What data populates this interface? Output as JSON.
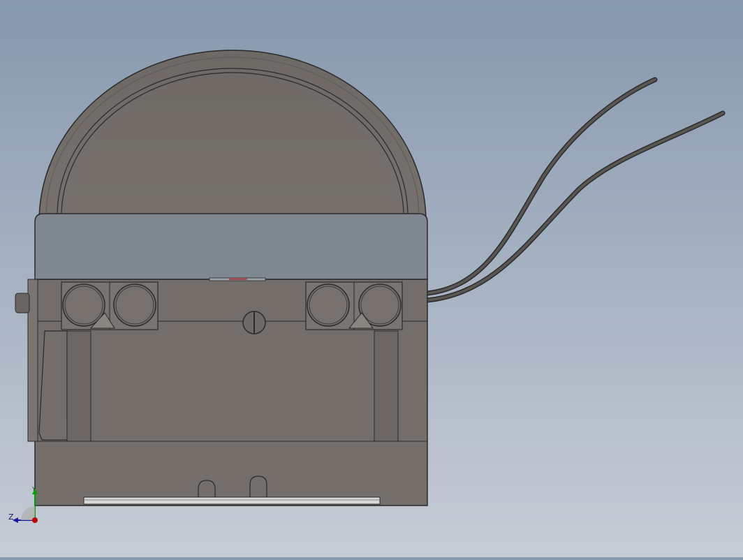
{
  "viewport": {
    "background_top": "#8799ae",
    "background_bottom": "#c7ccd6",
    "model": {
      "body_color": "#736e6a",
      "band_color": "#7f8891",
      "edge_color": "#2a2a2a",
      "wire_color": "#5a5652",
      "roller_count": 4,
      "wire_count": 2
    },
    "triad": {
      "axis_z_label": "Z",
      "axis_y_label": "Y",
      "axis_x_color": "#c00000",
      "axis_y_color": "#00a000",
      "axis_z_color": "#1a1aa0"
    }
  }
}
